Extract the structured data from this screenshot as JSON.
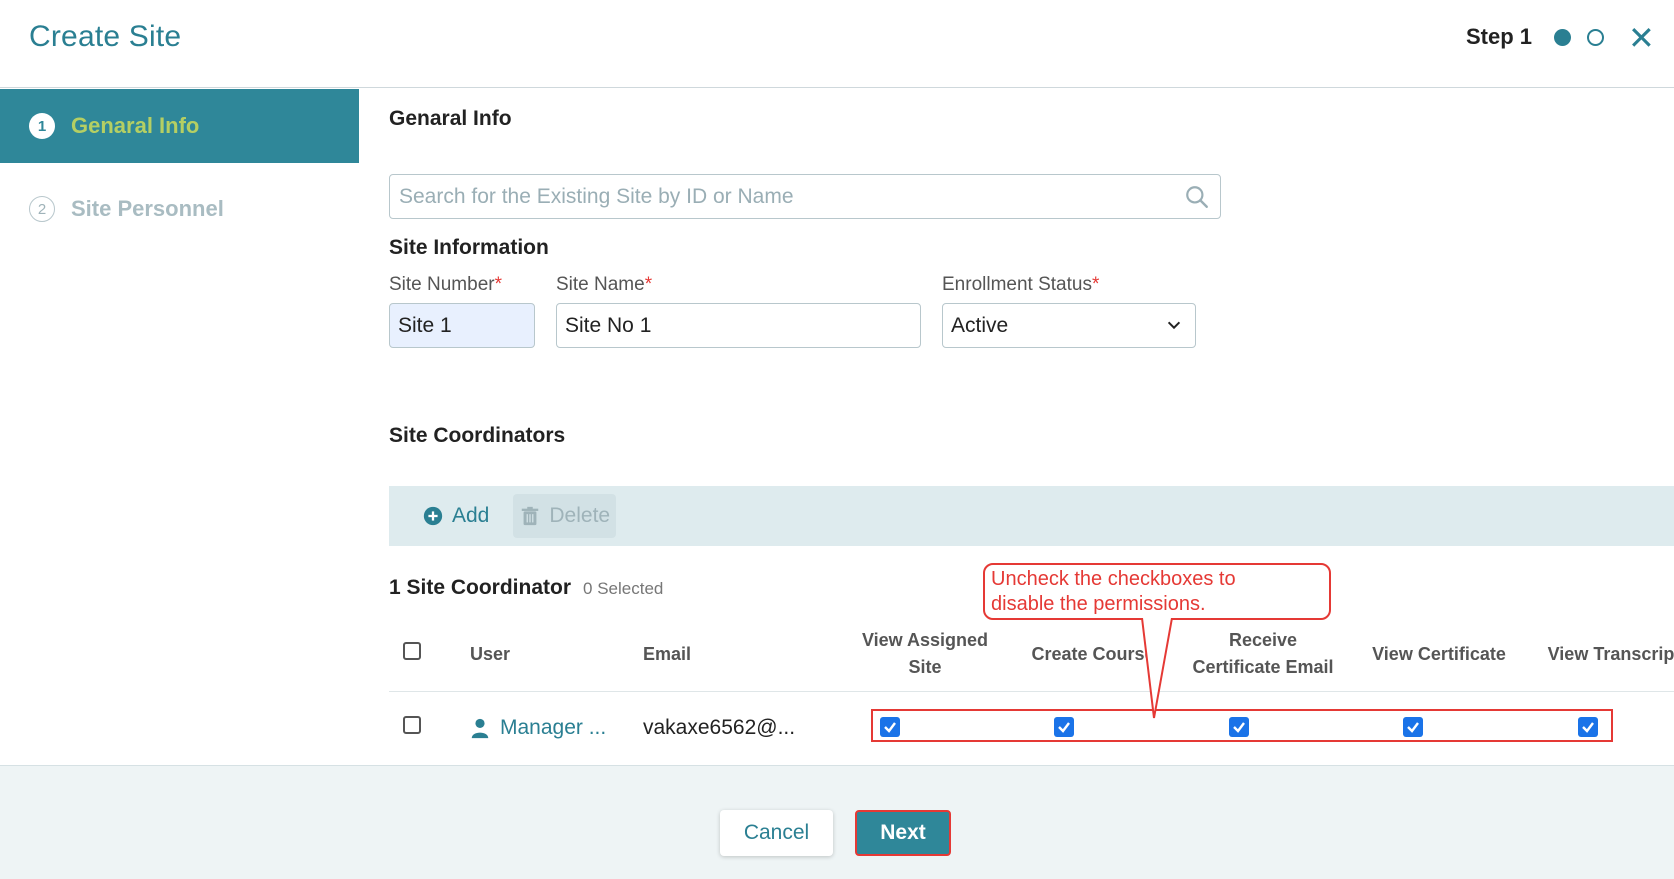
{
  "header": {
    "title": "Create Site",
    "step_label": "Step 1"
  },
  "sidebar": {
    "items": [
      {
        "num": "1",
        "label": "Genaral Info"
      },
      {
        "num": "2",
        "label": "Site Personnel"
      }
    ]
  },
  "main": {
    "section_title": "Genaral Info",
    "search_placeholder": "Search for the Existing Site by ID or Name",
    "site_info_title": "Site Information",
    "fields": {
      "site_number_label": "Site Number",
      "site_number_value": "Site 1",
      "site_name_label": "Site Name",
      "site_name_value": "Site No 1",
      "enrollment_label": "Enrollment Status",
      "enrollment_value": "Active",
      "required_mark": "*"
    },
    "coordinators_title": "Site Coordinators",
    "toolbar": {
      "add_label": "Add",
      "delete_label": "Delete"
    },
    "count_label": "1 Site Coordinator",
    "selected_label": "0 Selected",
    "table": {
      "headers": {
        "user": "User",
        "email": "Email",
        "view_assigned_site_1": "View Assigned",
        "view_assigned_site_2": "Site",
        "create_course": "Create Course",
        "receive_cert_1": "Receive",
        "receive_cert_2": "Certificate Email",
        "view_certificate": "View Certificate",
        "view_transcript": "View Transcript"
      },
      "rows": [
        {
          "user": "Manager ...",
          "email": "vakaxe6562@..."
        }
      ]
    },
    "callout": {
      "line1": "Uncheck the checkboxes to",
      "line2": "disable the permissions."
    }
  },
  "footer": {
    "cancel_label": "Cancel",
    "next_label": "Next"
  },
  "colors": {
    "accent": "#2a7f92",
    "active_sidebar": "#2f8799",
    "active_label": "#b5cf63",
    "annotation": "#e53935",
    "checkbox": "#1a73e8"
  }
}
